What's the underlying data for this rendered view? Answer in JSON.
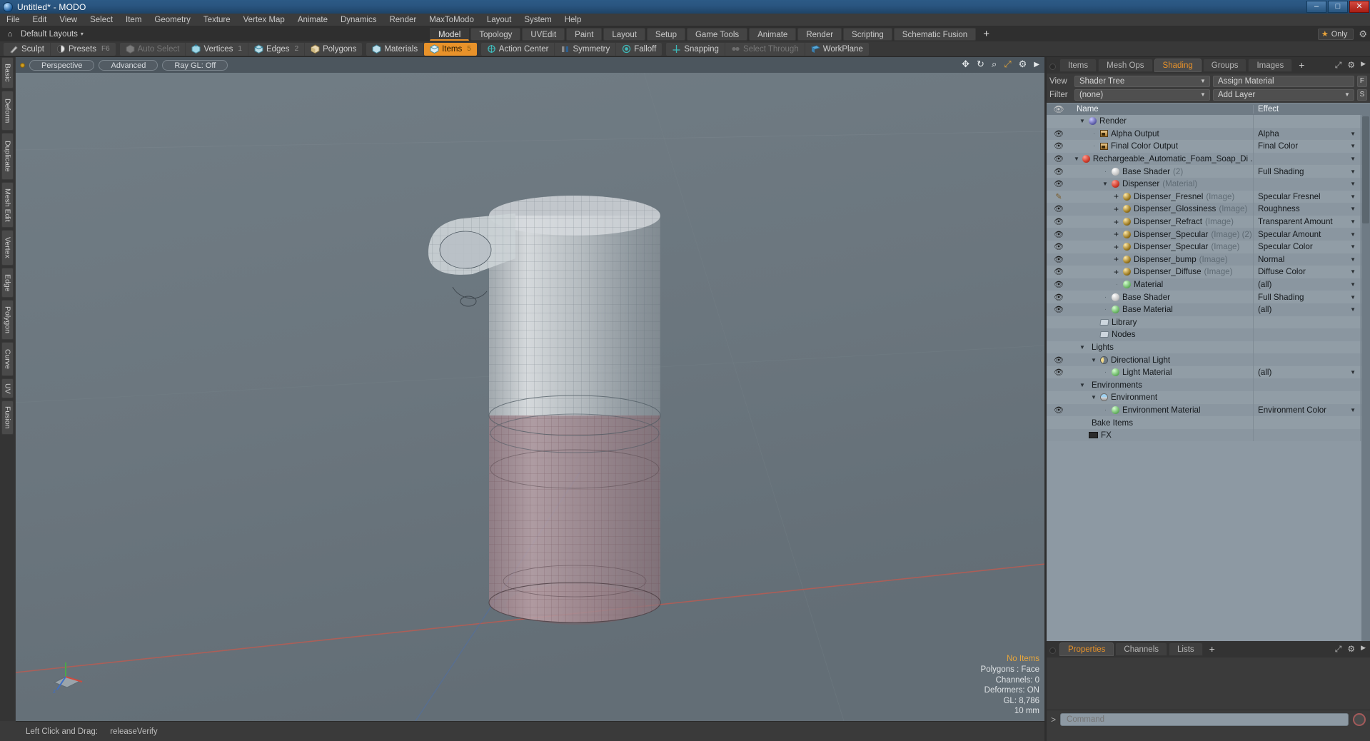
{
  "window": {
    "title": "Untitled* - MODO",
    "app_icon": "modo-logo-icon",
    "minimize": "–",
    "maximize": "□",
    "close": "✕"
  },
  "menubar": {
    "items": [
      "File",
      "Edit",
      "View",
      "Select",
      "Item",
      "Geometry",
      "Texture",
      "Vertex Map",
      "Animate",
      "Dynamics",
      "Render",
      "MaxToModo",
      "Layout",
      "System",
      "Help"
    ]
  },
  "layoutbar": {
    "home_icon": "home-icon",
    "layouts_label": "Default Layouts",
    "caret": "▾",
    "tabs": [
      {
        "label": "Model",
        "active": true
      },
      {
        "label": "Topology",
        "active": false
      },
      {
        "label": "UVEdit",
        "active": false
      },
      {
        "label": "Paint",
        "active": false
      },
      {
        "label": "Layout",
        "active": false
      },
      {
        "label": "Setup",
        "active": false
      },
      {
        "label": "Game Tools",
        "active": false
      },
      {
        "label": "Animate",
        "active": false
      },
      {
        "label": "Render",
        "active": false
      },
      {
        "label": "Scripting",
        "active": false
      },
      {
        "label": "Schematic Fusion",
        "active": false
      }
    ],
    "add_tab": "+",
    "only_star": "★",
    "only_label": "Only",
    "gear": "⚙"
  },
  "toolbar": {
    "group1": [
      {
        "label": "Sculpt",
        "icon": "sculpt-icon",
        "state": "normal",
        "num": ""
      },
      {
        "label": "Presets",
        "icon": "presets-icon",
        "state": "normal",
        "num": "F6"
      }
    ],
    "group2": [
      {
        "label": "Auto Select",
        "icon": "cube-grey-icon",
        "state": "dim",
        "num": ""
      },
      {
        "label": "Vertices",
        "icon": "cube-vertices-icon",
        "state": "normal",
        "num": "1"
      },
      {
        "label": "Edges",
        "icon": "cube-edges-icon",
        "state": "normal",
        "num": "2"
      },
      {
        "label": "Polygons",
        "icon": "cube-polygons-icon",
        "state": "normal",
        "num": ""
      }
    ],
    "group3": [
      {
        "label": "Materials",
        "icon": "cube-materials-icon",
        "state": "normal",
        "num": ""
      },
      {
        "label": "Items",
        "icon": "cube-items-icon",
        "state": "selected",
        "num": "5"
      }
    ],
    "group4": [
      {
        "label": "Action Center",
        "icon": "action-center-icon",
        "state": "normal",
        "num": ""
      },
      {
        "label": "Symmetry",
        "icon": "symmetry-icon",
        "state": "normal",
        "num": ""
      },
      {
        "label": "Falloff",
        "icon": "falloff-icon",
        "state": "normal",
        "num": ""
      }
    ],
    "group5": [
      {
        "label": "Snapping",
        "icon": "snapping-icon",
        "state": "normal",
        "num": ""
      },
      {
        "label": "Select Through",
        "icon": "select-through-icon",
        "state": "dim",
        "num": ""
      },
      {
        "label": "WorkPlane",
        "icon": "workplane-icon",
        "state": "normal",
        "num": ""
      }
    ]
  },
  "left_tabs": [
    "Basic",
    "Deform",
    "Duplicate",
    "Mesh Edit",
    "Vertex",
    "Edge",
    "Polygon",
    "Curve",
    "UV",
    "Fusion"
  ],
  "viewport": {
    "indicator": "viewport-active-dot",
    "pills": [
      "Perspective",
      "Advanced",
      "Ray GL: Off"
    ],
    "icons": [
      "move-icon",
      "rotate-icon",
      "zoom-icon",
      "fit-icon",
      "gear-icon",
      "chevron-right-icon"
    ],
    "stats": {
      "selection": "No Items",
      "mode": "Polygons : Face",
      "channels": "Channels: 0",
      "deformers": "Deformers: ON",
      "gl": "GL: 8,786",
      "scale": "10 mm"
    },
    "gizmo_axes": [
      "x-axis",
      "y-axis",
      "z-axis"
    ],
    "model": "soap-dispenser-wireframe"
  },
  "statusbar": {
    "hint_label": "Left Click and Drag:",
    "hint_value": "releaseVerify"
  },
  "right_panel": {
    "tabs": [
      {
        "label": "Items",
        "active": false
      },
      {
        "label": "Mesh Ops",
        "active": false
      },
      {
        "label": "Shading",
        "active": true
      },
      {
        "label": "Groups",
        "active": false
      },
      {
        "label": "Images",
        "active": false
      }
    ],
    "add_tab": "+",
    "tab_icons": [
      "expand-icon",
      "gear-icon",
      "chevron-right-icon"
    ],
    "view_label": "View",
    "view_value": "Shader Tree",
    "assign_material": "Assign Material",
    "assign_btn": "F",
    "filter_label": "Filter",
    "filter_value": "(none)",
    "add_layer": "Add Layer",
    "add_layer_btn": "S",
    "columns": {
      "eye": "eye-icon",
      "name": "Name",
      "effect": "Effect"
    },
    "tree": [
      {
        "eye": "none",
        "indent": 0,
        "twist": "▼",
        "icon": "sphere-render",
        "name": "Render",
        "sub": "",
        "effect": ""
      },
      {
        "eye": "eye",
        "indent": 1,
        "twist": "dot",
        "icon": "image-output",
        "name": "Alpha Output",
        "sub": "",
        "effect": "Alpha"
      },
      {
        "eye": "eye",
        "indent": 1,
        "twist": "dot",
        "icon": "image-output",
        "name": "Final Color Output",
        "sub": "",
        "effect": "Final Color"
      },
      {
        "eye": "eye",
        "indent": 1,
        "twist": "▼",
        "icon": "sphere-red",
        "name": "Rechargeable_Automatic_Foam_Soap_Di ...",
        "sub": "",
        "effect": ""
      },
      {
        "eye": "eye",
        "indent": 2,
        "twist": "dot",
        "icon": "sphere-white",
        "name": "Base Shader",
        "sub": "(2)",
        "effect": "Full Shading"
      },
      {
        "eye": "eye",
        "indent": 2,
        "twist": "▼",
        "icon": "sphere-red",
        "name": "Dispenser",
        "sub": "(Material)",
        "effect": ""
      },
      {
        "eye": "brush",
        "indent": 3,
        "twist": "plus",
        "icon": "sphere-gold",
        "name": "Dispenser_Fresnel",
        "sub": "(Image)",
        "effect": "Specular Fresnel"
      },
      {
        "eye": "eye",
        "indent": 3,
        "twist": "plus",
        "icon": "sphere-gold",
        "name": "Dispenser_Glossiness",
        "sub": "(Image)",
        "effect": "Roughness"
      },
      {
        "eye": "eye",
        "indent": 3,
        "twist": "plus",
        "icon": "sphere-gold",
        "name": "Dispenser_Refract",
        "sub": "(Image)",
        "effect": "Transparent Amount"
      },
      {
        "eye": "eye",
        "indent": 3,
        "twist": "plus",
        "icon": "sphere-gold",
        "name": "Dispenser_Specular",
        "sub": "(Image) (2)",
        "effect": "Specular Amount"
      },
      {
        "eye": "eye",
        "indent": 3,
        "twist": "plus",
        "icon": "sphere-gold",
        "name": "Dispenser_Specular",
        "sub": "(Image)",
        "effect": "Specular Color"
      },
      {
        "eye": "eye",
        "indent": 3,
        "twist": "plus",
        "icon": "sphere-gold",
        "name": "Dispenser_bump",
        "sub": "(Image)",
        "effect": "Normal"
      },
      {
        "eye": "eye",
        "indent": 3,
        "twist": "plus",
        "icon": "sphere-gold",
        "name": "Dispenser_Diffuse",
        "sub": "(Image)",
        "effect": "Diffuse Color"
      },
      {
        "eye": "eye",
        "indent": 3,
        "twist": "dot",
        "icon": "sphere-green",
        "name": "Material",
        "sub": "",
        "effect": "(all)"
      },
      {
        "eye": "eye",
        "indent": 2,
        "twist": "dot",
        "icon": "sphere-white",
        "name": "Base Shader",
        "sub": "",
        "effect": "Full Shading"
      },
      {
        "eye": "eye",
        "indent": 2,
        "twist": "dot",
        "icon": "sphere-green",
        "name": "Base Material",
        "sub": "",
        "effect": "(all)"
      },
      {
        "eye": "none",
        "indent": 1,
        "twist": "none",
        "icon": "folder",
        "name": "Library",
        "sub": "",
        "effect": ""
      },
      {
        "eye": "none",
        "indent": 1,
        "twist": "none",
        "icon": "folder",
        "name": "Nodes",
        "sub": "",
        "effect": ""
      },
      {
        "eye": "none",
        "indent": 0,
        "twist": "▼",
        "icon": "none",
        "name": "Lights",
        "sub": "",
        "effect": ""
      },
      {
        "eye": "eye",
        "indent": 1,
        "twist": "▼",
        "icon": "light",
        "name": "Directional Light",
        "sub": "",
        "effect": ""
      },
      {
        "eye": "eye",
        "indent": 2,
        "twist": "dot",
        "icon": "sphere-green",
        "name": "Light Material",
        "sub": "",
        "effect": "(all)"
      },
      {
        "eye": "none",
        "indent": 0,
        "twist": "▼",
        "icon": "none",
        "name": "Environments",
        "sub": "",
        "effect": ""
      },
      {
        "eye": "none",
        "indent": 1,
        "twist": "▼",
        "icon": "sphere-env",
        "name": "Environment",
        "sub": "",
        "effect": ""
      },
      {
        "eye": "eye",
        "indent": 2,
        "twist": "dot",
        "icon": "sphere-green",
        "name": "Environment Material",
        "sub": "",
        "effect": "Environment Color"
      },
      {
        "eye": "none",
        "indent": 0,
        "twist": "none",
        "icon": "none",
        "name": "Bake Items",
        "sub": "",
        "effect": ""
      },
      {
        "eye": "none",
        "indent": 0,
        "twist": "none",
        "icon": "fx",
        "name": "FX",
        "sub": "",
        "effect": ""
      }
    ]
  },
  "bottom_panel": {
    "tabs": [
      {
        "label": "Properties",
        "active": true
      },
      {
        "label": "Channels",
        "active": false
      },
      {
        "label": "Lists",
        "active": false
      }
    ],
    "add_tab": "+",
    "tab_icons": [
      "expand-icon",
      "gear-icon",
      "chevron-right-icon"
    ],
    "command_caret": ">",
    "command_placeholder": "Command",
    "record_icon": "record-icon"
  },
  "colors": {
    "accent": "#e8922a",
    "title_bar": "#2a5580",
    "viewport_bg": "#6c777f",
    "tree_bg": "#8d99a3",
    "panel_bg": "#3b3b3b"
  }
}
